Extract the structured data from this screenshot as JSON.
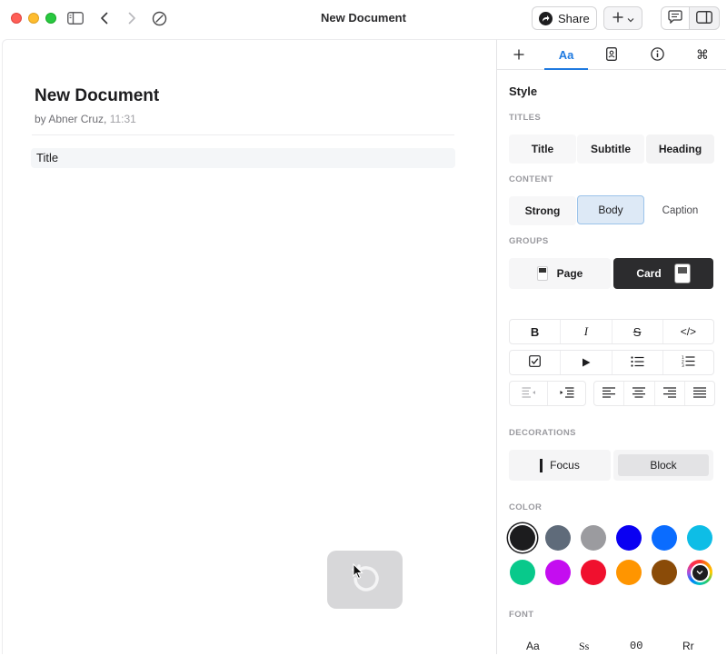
{
  "window": {
    "title": "New Document"
  },
  "toolbar": {
    "share_label": "Share"
  },
  "document": {
    "title": "New Document",
    "author_line": "by Abner Cruz,",
    "time": "11:31",
    "blocks": [
      {
        "style": "Title",
        "text": "Title"
      }
    ]
  },
  "inspector": {
    "tabs": [
      {
        "name": "plus",
        "label": "+"
      },
      {
        "name": "style",
        "label": "Aa",
        "active": true
      },
      {
        "name": "document",
        "label": ""
      },
      {
        "name": "info",
        "label": ""
      },
      {
        "name": "shortcuts",
        "label": "⌘"
      }
    ],
    "heading": "Style",
    "titles": {
      "label": "TITLES",
      "options": [
        "Title",
        "Subtitle",
        "Heading"
      ]
    },
    "content": {
      "label": "CONTENT",
      "options": [
        "Strong",
        "Body",
        "Caption"
      ],
      "selected": "Body"
    },
    "groups": {
      "label": "GROUPS",
      "options": [
        "Page",
        "Card"
      ],
      "selected": "Card"
    },
    "format_buttons": [
      "B",
      "I",
      "S",
      "</>"
    ],
    "decorations": {
      "label": "DECORATIONS",
      "options": [
        "Focus",
        "Block"
      ]
    },
    "color": {
      "label": "COLOR",
      "swatches": [
        "#1c1c1e",
        "#5f6b7a",
        "#9b9b9f",
        "#0a00f2",
        "#0a6cff",
        "#0ebde6",
        "#08c98b",
        "#c40df0",
        "#f0102e",
        "#ff9500",
        "#8a4b08",
        "picker"
      ],
      "selected_index": 0
    },
    "font": {
      "label": "FONT",
      "options": [
        "Aa",
        "Ss",
        "00",
        "Rr"
      ]
    }
  }
}
